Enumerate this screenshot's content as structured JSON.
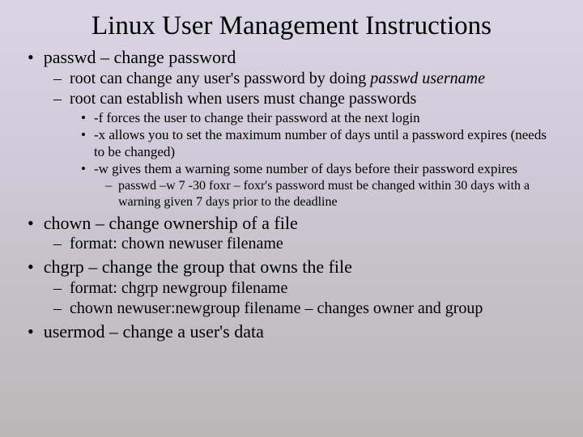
{
  "title": "Linux User Management Instructions",
  "b1": {
    "cmd": "passwd – change password",
    "sub1_pre": "root can change any user's password by doing ",
    "sub1_em": "passwd username",
    "sub2": "root can establish when users must change passwords",
    "f": "-f forces the user to change their password at the next login",
    "x": "-x allows you to set the maximum number of days until a password expires (needs to be changed)",
    "w": "-w gives them a warning some number of days before their password expires",
    "ex": "passwd –w 7 -30 foxr – foxr's password must be changed within 30 days with a warning given 7 days prior to the deadline"
  },
  "b2": {
    "cmd": "chown – change ownership of a file",
    "fmt": "format:  chown newuser filename"
  },
  "b3": {
    "cmd": "chgrp – change the group that owns the file",
    "fmt": "format:  chgrp newgroup filename",
    "combo": "chown newuser:newgroup filename – changes owner and group"
  },
  "b4": {
    "cmd": "usermod – change a user's data"
  }
}
